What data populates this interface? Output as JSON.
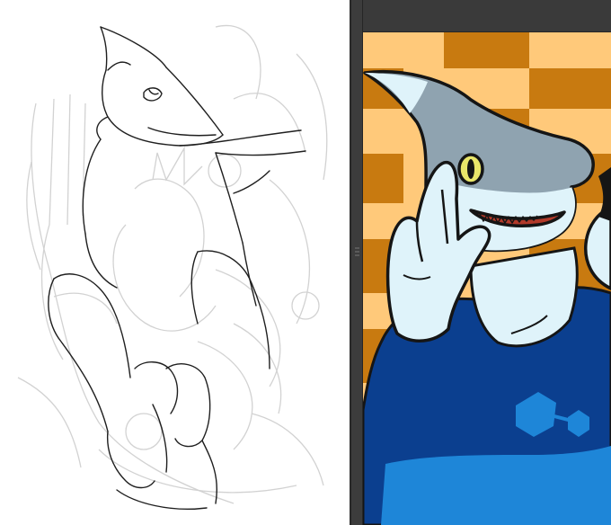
{
  "app": {
    "left_canvas": {
      "kind": "sketch-canvas",
      "icon": "pencil-sketch"
    },
    "right_canvas": {
      "kind": "color-canvas",
      "icon": "colored-artwork"
    }
  },
  "colors": {
    "sketch_line": "#1f1f1f",
    "sketch_faint": "#cfcfcf",
    "check_light": "#ffc97a",
    "check_dark": "#c87a10",
    "shark_gray": "#8fa3b0",
    "shark_light": "#dff3fa",
    "shirt_dark": "#0b3f8f",
    "shirt_light": "#1e86d8"
  }
}
